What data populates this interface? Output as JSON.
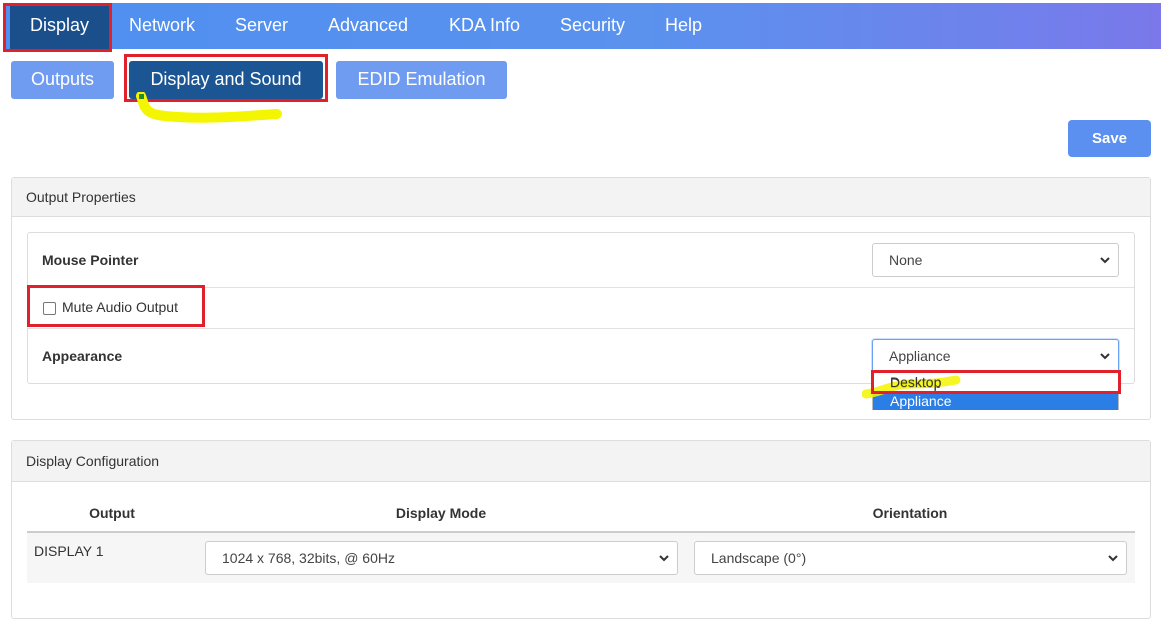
{
  "nav": {
    "items": [
      "Display",
      "Network",
      "Server",
      "Advanced",
      "KDA Info",
      "Security",
      "Help"
    ]
  },
  "subtabs": [
    "Outputs",
    "Display and Sound",
    "EDID Emulation"
  ],
  "toolbar": {
    "save_label": "Save"
  },
  "output_properties": {
    "title": "Output Properties",
    "mouse_pointer": {
      "label": "Mouse Pointer",
      "value": "None"
    },
    "mute_audio": {
      "label": "Mute Audio Output",
      "checked": false
    },
    "appearance": {
      "label": "Appearance",
      "value": "Appliance",
      "options": [
        "Desktop",
        "Appliance"
      ],
      "selected_option": "Appliance"
    }
  },
  "display_configuration": {
    "title": "Display Configuration",
    "headers": [
      "Output",
      "Display Mode",
      "Orientation"
    ],
    "rows": [
      {
        "output": "DISPLAY 1",
        "mode": "1024 x 768, 32bits, @ 60Hz",
        "orientation": "Landscape (0°)"
      }
    ]
  },
  "colors": {
    "nav_active": "#1b4f8c",
    "subtab_active": "#1c5593",
    "subtab": "#6f9cf0",
    "save": "#5b8ff0",
    "highlight_red": "#e0202a",
    "highlight_yellow": "#f4f500",
    "option_selected": "#2a7ee6"
  }
}
